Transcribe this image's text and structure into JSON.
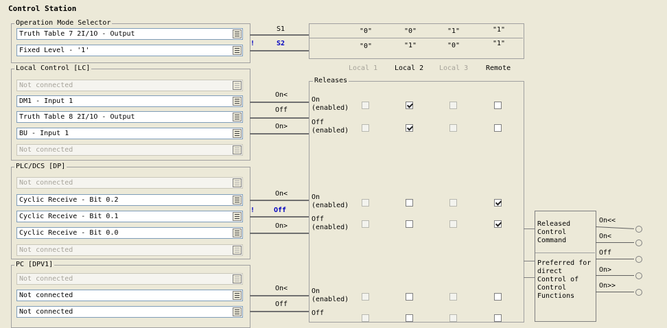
{
  "title": "Control Station",
  "op_mode": {
    "label": "Operation Mode Selector",
    "fields": [
      "Truth Table 7 2I/1O - Output",
      "Fixed Level - '1'"
    ],
    "signals": [
      "S1",
      "S2"
    ],
    "warning": "!",
    "table": [
      [
        "\"0\"",
        "\"0\"",
        "\"1\"",
        "\"1\""
      ],
      [
        "\"0\"",
        "\"1\"",
        "\"0\"",
        "\"1\""
      ]
    ]
  },
  "columns": [
    "Local 1",
    "Local 2",
    "Local 3",
    "Remote"
  ],
  "releases_label": "Releases",
  "local_control": {
    "label": "Local Control [LC]",
    "fields": [
      "Not connected",
      "DM1 - Input 1",
      "Truth Table 8 2I/1O - Output",
      "BU - Input 1",
      "Not connected"
    ],
    "signals": [
      "On<",
      "Off",
      "On>"
    ]
  },
  "plc_dcs": {
    "label": "PLC/DCS [DP]",
    "fields": [
      "Not connected",
      "Cyclic Receive - Bit 0.2",
      "Cyclic Receive - Bit 0.1",
      "Cyclic Receive - Bit 0.0",
      "Not connected"
    ],
    "signals": [
      "On<",
      "Off",
      "On>"
    ],
    "warning": "!"
  },
  "pc_dpv1": {
    "label": "PC [DPV1]",
    "fields": [
      "Not connected",
      "Not connected",
      "Not connected"
    ],
    "signals": [
      "On<",
      "Off"
    ]
  },
  "release_rows": [
    {
      "line1": "On",
      "line2": "(enabled)",
      "checks": [
        false,
        true,
        false,
        false
      ]
    },
    {
      "line1": "Off",
      "line2": "(enabled)",
      "checks": [
        false,
        true,
        false,
        false
      ]
    },
    {
      "line1": "On",
      "line2": "(enabled)",
      "checks": [
        false,
        false,
        false,
        true
      ]
    },
    {
      "line1": "Off",
      "line2": "(enabled)",
      "checks": [
        false,
        false,
        false,
        true
      ]
    },
    {
      "line1": "On",
      "line2": "(enabled)",
      "checks": [
        false,
        false,
        false,
        false
      ]
    },
    {
      "line1": "Off",
      "line2": "",
      "checks": [
        false,
        false,
        false,
        false
      ]
    }
  ],
  "released_box": {
    "line1": "Released",
    "line2": "Control",
    "line3": "Command",
    "pref1": "Preferred for",
    "pref2": "direct",
    "pref3": "Control of",
    "pref4": "Control",
    "pref5": "Functions"
  },
  "outputs": [
    "On<<",
    "On<",
    "Off",
    "On>",
    "On>>"
  ]
}
